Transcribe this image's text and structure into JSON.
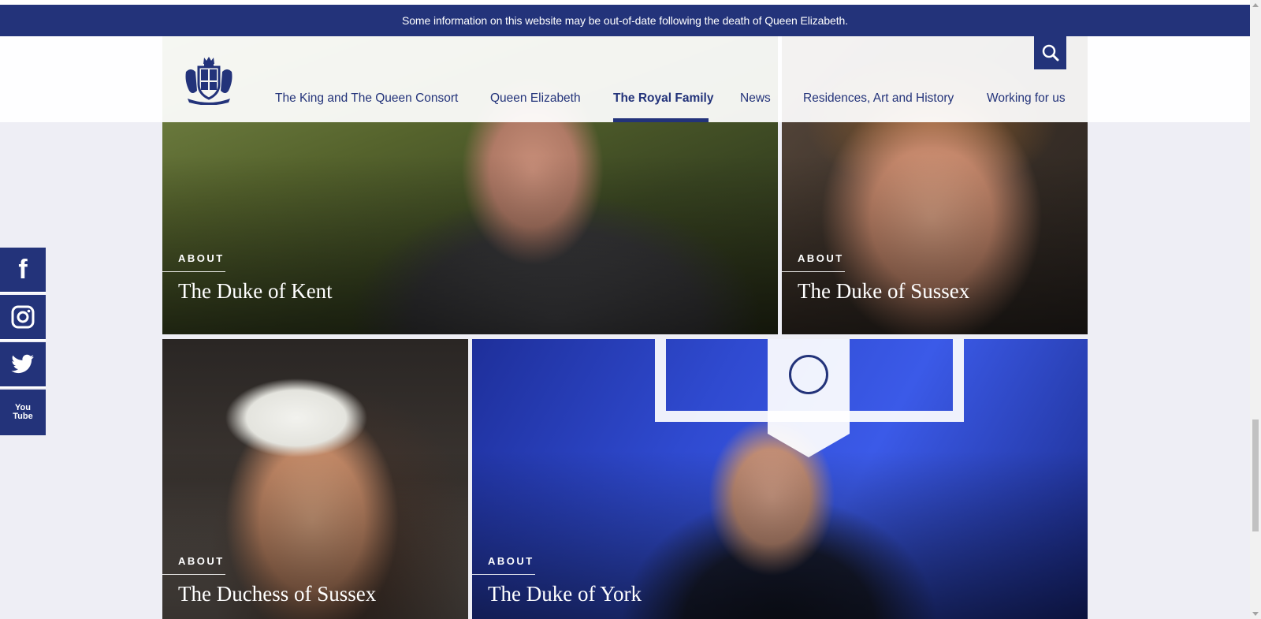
{
  "notice": {
    "text": "Some information on this website may be out-of-date following the death of Queen Elizabeth."
  },
  "header": {
    "logo": "royal-coat-of-arms",
    "nav": [
      {
        "label": "The King and The Queen Consort",
        "active": false
      },
      {
        "label": "Queen Elizabeth",
        "active": false
      },
      {
        "label": "The Royal Family",
        "active": true
      },
      {
        "label": "News",
        "active": false
      },
      {
        "label": "Residences, Art and History",
        "active": false
      },
      {
        "label": "Working for us",
        "active": false
      }
    ],
    "search_icon": "search-icon"
  },
  "cards": [
    {
      "kicker": "ABOUT",
      "title": "The Duke of Kent"
    },
    {
      "kicker": "ABOUT",
      "title": "The Duke of Sussex"
    },
    {
      "kicker": "ABOUT",
      "title": "The Duchess of Sussex"
    },
    {
      "kicker": "ABOUT",
      "title": "The Duke of York"
    }
  ],
  "social": [
    {
      "icon": "facebook-icon"
    },
    {
      "icon": "instagram-icon"
    },
    {
      "icon": "twitter-icon"
    },
    {
      "icon": "youtube-icon",
      "label_top": "You",
      "label_bottom": "Tube"
    }
  ],
  "colors": {
    "brand": "#23337a",
    "background": "#eeeef5",
    "header": "#ffffff"
  }
}
